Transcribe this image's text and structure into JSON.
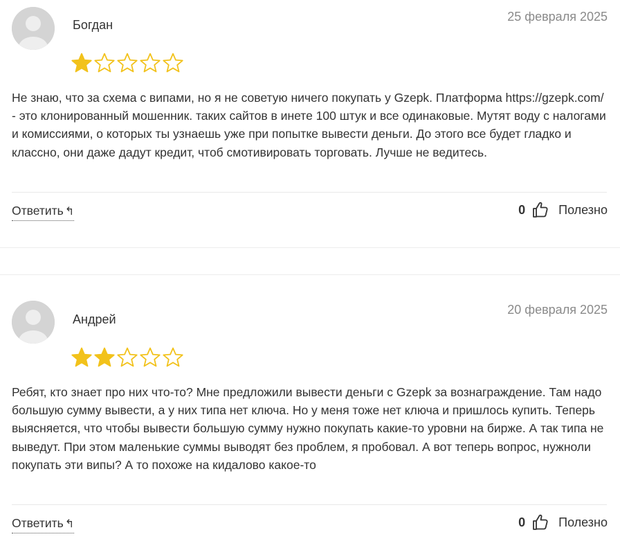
{
  "reviews": [
    {
      "author": "Богдан",
      "date": "25 февраля 2025",
      "rating": 1,
      "max_rating": 5,
      "text": "Не знаю, что за схема с випами, но я не советую ничего покупать у Gzepk. Платформа https://gzepk.com/ - это клонированный мошенник. таких сайтов в инете 100 штук и все одинаковые. Мутят воду с налогами и комиссиями, о которых ты узнаешь уже при попытке вывести деньги. До этого все будет гладко и классно, они даже дадут кредит, чтоб смотивировать торговать. Лучше не ведитесь.",
      "reply_label": "Ответить",
      "useful_count": "0",
      "useful_label": "Полезно"
    },
    {
      "author": "Андрей",
      "date": "20 февраля 2025",
      "rating": 2,
      "max_rating": 5,
      "text": "Ребят, кто знает про них что-то? Мне предложили вывести деньги с Gzepk за вознаграждение. Там надо большую сумму вывести, а у них типа нет ключа. Но у меня тоже нет ключа и пришлось купить. Теперь выясняется, что чтобы вывести большую сумму нужно покупать какие-то уровни на бирже. А так типа не выведут. При этом маленькие суммы выводят без проблем, я пробовал. А вот теперь вопрос, нужноли покупать эти випы? А то похоже на кидалово какое-то",
      "reply_label": "Ответить",
      "useful_count": "0",
      "useful_label": "Полезно"
    }
  ],
  "colors": {
    "star_filled": "#F2C21B",
    "star_empty_stroke": "#F2C21B",
    "avatar_bg": "#D4D4D4",
    "date_text": "#8A8A8A"
  },
  "icons": {
    "reply": "reply-arrow-icon",
    "useful": "thumbs-up-icon",
    "avatar": "user-silhouette-icon"
  }
}
